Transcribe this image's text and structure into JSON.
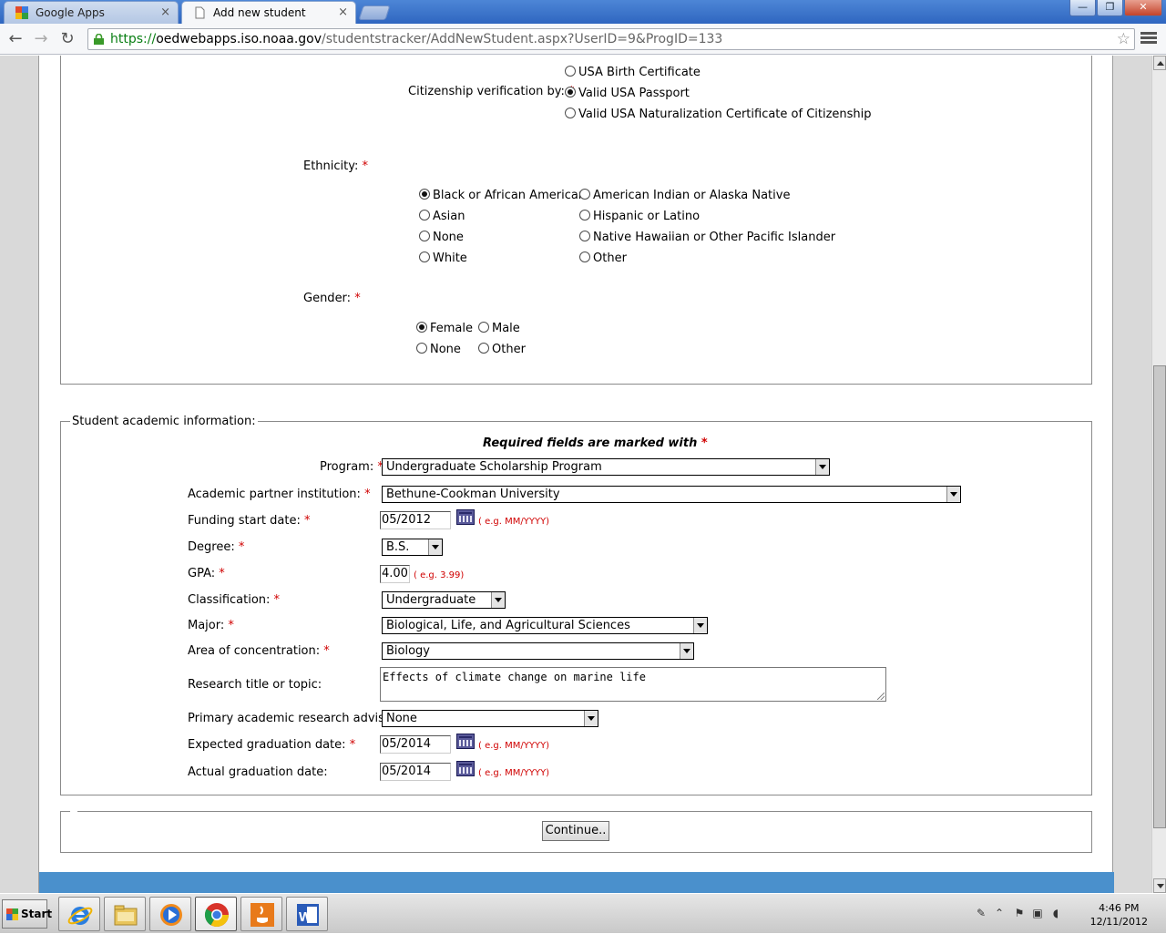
{
  "browser": {
    "tabs": [
      {
        "label": "Google Apps",
        "active": false
      },
      {
        "label": "Add new student",
        "active": true
      }
    ],
    "tab_close_glyph": "×",
    "window_buttons": {
      "minimize": "—",
      "maximize": "❐",
      "close": "✕"
    },
    "url": {
      "scheme": "https://",
      "host": "oedwebapps.iso.noaa.gov",
      "path": "/studentstracker/AddNewStudent.aspx?UserID=9&ProgID=133"
    },
    "nav": {
      "back": "←",
      "forward": "→",
      "reload": "↻",
      "star": "☆"
    }
  },
  "citizenship": {
    "label": "Citizenship verification by:",
    "required": "*",
    "options": [
      {
        "label": "USA Birth Certificate",
        "checked": false
      },
      {
        "label": "Valid USA Passport",
        "checked": true
      },
      {
        "label": "Valid USA Naturalization Certificate of Citizenship",
        "checked": false
      }
    ]
  },
  "ethnicity": {
    "label": "Ethnicity:",
    "required": "*",
    "options": [
      {
        "label": "Black or African American",
        "checked": true
      },
      {
        "label": "Asian",
        "checked": false
      },
      {
        "label": "None",
        "checked": false
      },
      {
        "label": "White",
        "checked": false
      },
      {
        "label": "American Indian or Alaska Native",
        "checked": false
      },
      {
        "label": "Hispanic or Latino",
        "checked": false
      },
      {
        "label": "Native Hawaiian or Other Pacific Islander",
        "checked": false
      },
      {
        "label": "Other",
        "checked": false
      }
    ]
  },
  "gender": {
    "label": "Gender:",
    "required": "*",
    "options": [
      {
        "label": "Female",
        "checked": true
      },
      {
        "label": "Male",
        "checked": false
      },
      {
        "label": "None",
        "checked": false
      },
      {
        "label": "Other",
        "checked": false
      }
    ]
  },
  "academic": {
    "legend": "Student academic information:",
    "required_note": "Required fields are marked with",
    "required_mark": "*",
    "program": {
      "label": "Program:",
      "value": "Undergraduate Scholarship Program"
    },
    "institution": {
      "label": "Academic partner institution:",
      "value": "Bethune-Cookman University"
    },
    "funding_start": {
      "label": "Funding start date:",
      "value": "05/2012",
      "hint": "( e.g. MM/YYYY)"
    },
    "degree": {
      "label": "Degree:",
      "value": "B.S."
    },
    "gpa": {
      "label": "GPA:",
      "value": "4.00",
      "hint": "( e.g. 3.99)"
    },
    "classification": {
      "label": "Classification:",
      "value": "Undergraduate"
    },
    "major": {
      "label": "Major:",
      "value": "Biological, Life, and Agricultural Sciences"
    },
    "concentration": {
      "label": "Area of concentration:",
      "value": "Biology"
    },
    "research_title": {
      "label": "Research title or topic:",
      "value": "Effects of climate change on marine life"
    },
    "advisor": {
      "label": "Primary academic research advisor:",
      "value": "None"
    },
    "expected_grad": {
      "label": "Expected graduation date:",
      "value": "05/2014",
      "hint": "( e.g. MM/YYYY)"
    },
    "actual_grad": {
      "label": "Actual graduation date:",
      "value": "05/2014",
      "hint": "( e.g. MM/YYYY)"
    }
  },
  "continue_button": "Continue..",
  "taskbar": {
    "start_label": "Start",
    "apps": [
      "internet-explorer",
      "windows-explorer",
      "media-player",
      "chrome",
      "java",
      "word"
    ],
    "word_letter": "W",
    "clock_time": "4:46 PM",
    "clock_date": "12/11/2012"
  },
  "colors": {
    "required": "#d00000",
    "footer_band": "#4a90cc",
    "url_scheme": "#0a7f14"
  }
}
